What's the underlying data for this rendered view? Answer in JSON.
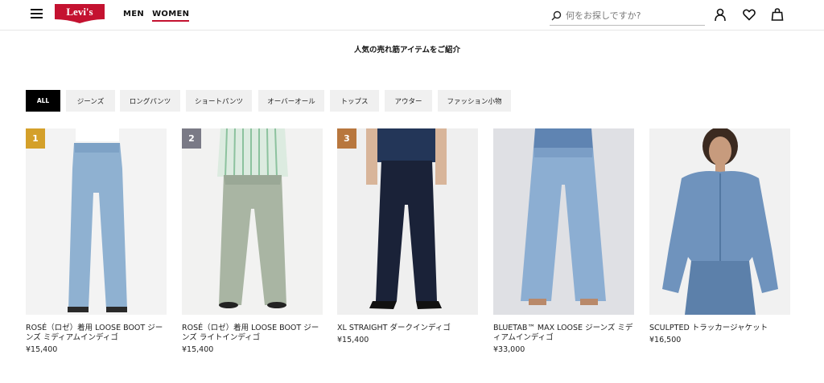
{
  "header": {
    "logo_text": "Levi's",
    "nav": [
      {
        "label": "MEN",
        "active": false
      },
      {
        "label": "WOMEN",
        "active": true
      }
    ],
    "search_placeholder": "何をお探しですか?",
    "accent_color": "#c41230"
  },
  "section_title": "人気の売れ筋アイテムをご紹介",
  "filters": [
    {
      "label": "ALL",
      "active": true
    },
    {
      "label": "ジーンズ",
      "active": false
    },
    {
      "label": "ロングパンツ",
      "active": false
    },
    {
      "label": "ショートパンツ",
      "active": false
    },
    {
      "label": "オーバーオール",
      "active": false
    },
    {
      "label": "トップス",
      "active": false
    },
    {
      "label": "アウター",
      "active": false
    },
    {
      "label": "ファッション小物",
      "active": false
    }
  ],
  "products": [
    {
      "rank": "1",
      "rank_color": "#d4a02a",
      "name": "ROSÉ（ロゼ）着用 LOOSE BOOT ジーンズ ミディアムインディゴ",
      "price": "¥15,400"
    },
    {
      "rank": "2",
      "rank_color": "#7a7a86",
      "name": "ROSÉ（ロゼ）着用 LOOSE BOOT ジーンズ ライトインディゴ",
      "price": "¥15,400"
    },
    {
      "rank": "3",
      "rank_color": "#b8773e",
      "name": "XL STRAIGHT ダークインディゴ",
      "price": "¥15,400"
    },
    {
      "rank": "",
      "rank_color": "",
      "name": "BLUETAB™ MAX LOOSE ジーンズ ミディアムインディゴ",
      "price": "¥33,000"
    },
    {
      "rank": "",
      "rank_color": "",
      "name": "SCULPTED トラッカージャケット",
      "price": "¥16,500"
    }
  ]
}
